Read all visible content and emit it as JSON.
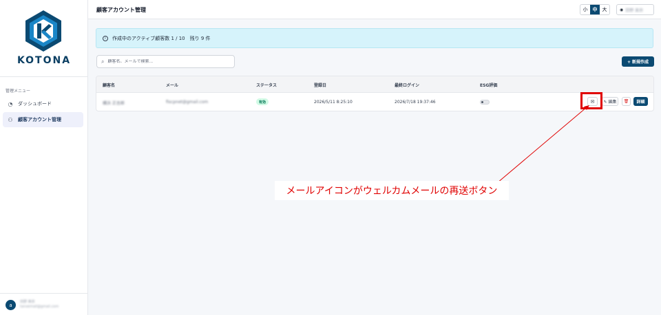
{
  "brand": {
    "name": "KOTONA",
    "primary": "#0b4a72"
  },
  "sidebar": {
    "menu_title": "管理メニュー",
    "items": [
      {
        "label": "ダッシュボード",
        "icon": "speedometer-icon"
      },
      {
        "label": "顧客アカウント管理",
        "icon": "users-icon",
        "active": true
      }
    ],
    "footer": {
      "avatar_text": "a",
      "name": "田野 美奈",
      "email": "tanoemail@gmail.com"
    }
  },
  "header": {
    "title": "顧客アカウント管理",
    "sizes": [
      "小",
      "中",
      "大"
    ],
    "active_size": "中",
    "user_name": "田野 美奈"
  },
  "banner": {
    "icon": "info-icon",
    "text": "作成中のアクティブ顧客数 1 / 10　残り 9 件"
  },
  "search": {
    "placeholder": "顧客名、メールで検索..."
  },
  "new_button": {
    "label": "+ 新規作成"
  },
  "table": {
    "columns": [
      "顧客名",
      "メール",
      "ステータス",
      "登録日",
      "最終ログイン",
      "ESG評価"
    ],
    "rows": [
      {
        "name": "横浜 正吉郎",
        "email": "fiscpnet@gmail.com",
        "status": "有効",
        "registered": "2026/5/11 8:25:10",
        "last_login": "2026/7/18 19:37:46",
        "esg_enabled": false
      }
    ],
    "actions": {
      "mail_icon": "mail-icon",
      "edit": "✎ 編集",
      "delete_icon": "trash-icon",
      "detail": "詳細"
    }
  },
  "annotation": {
    "text": "メールアイコンがウェルカムメールの再送ボタン",
    "color": "#e00000"
  }
}
